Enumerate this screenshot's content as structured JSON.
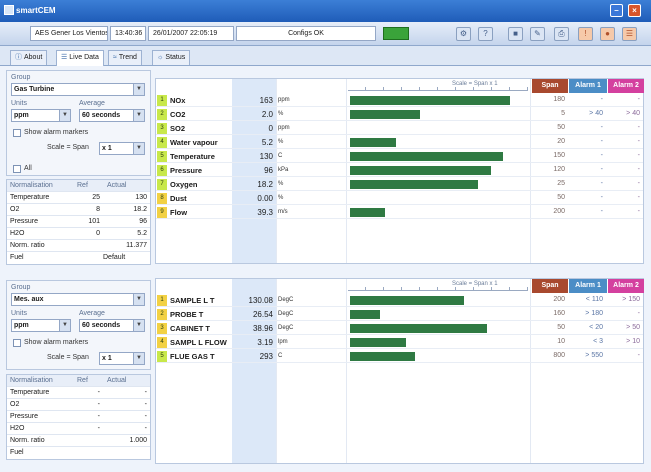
{
  "window": {
    "title": "smartCEM"
  },
  "toolbar": {
    "site": "AES Gener Los Vientos",
    "time": "13:40:36",
    "datetime": "26/01/2007 22:05:19",
    "status": "Configs OK"
  },
  "tabs": [
    {
      "label": "About",
      "icon": "info-icon"
    },
    {
      "label": "Live Data",
      "icon": "list-icon"
    },
    {
      "label": "Trend",
      "icon": "chart-icon"
    },
    {
      "label": "Status",
      "icon": "status-icon"
    }
  ],
  "colors": {
    "bar": "#2f7a43",
    "span_header": "#a8492f",
    "alarm1_header": "#4b8dc6",
    "alarm2_header": "#d4409f",
    "value_column": "#dce8f8"
  },
  "labels": {
    "group": "Group",
    "units": "Units",
    "average": "Average",
    "show_alarm_markers": "Show alarm markers",
    "scale_prefix": "Scale = Span",
    "all": "All",
    "scale_header": "Scale = Span x 1",
    "span": "Span",
    "alarm1": "Alarm 1",
    "alarm2": "Alarm 2",
    "normalisation": "Normalisation",
    "ref": "Ref",
    "actual": "Actual"
  },
  "panel1": {
    "group": "Gas Turbine",
    "units": "ppm",
    "average": "60 seconds",
    "scale": "x 1",
    "norm_rows": [
      {
        "name": "Temperature",
        "ref": "25",
        "actual": "130"
      },
      {
        "name": "O2",
        "ref": "8",
        "actual": "18.2"
      },
      {
        "name": "Pressure",
        "ref": "101",
        "actual": "96"
      },
      {
        "name": "H2O",
        "ref": "0",
        "actual": "5.2"
      },
      {
        "name": "Norm. ratio",
        "ref": "",
        "actual": "11.377"
      },
      {
        "name": "Fuel",
        "ref": "",
        "actual": "Default"
      }
    ],
    "rows": [
      {
        "n": "1",
        "color": "#c8e84a",
        "name": "NOx",
        "value": "163",
        "unit": "ppm",
        "fraction": 0.91,
        "span": "180",
        "a1": "-",
        "a2": "-"
      },
      {
        "n": "2",
        "color": "#c8e84a",
        "name": "CO2",
        "value": "2.0",
        "unit": "%",
        "fraction": 0.4,
        "span": "5",
        "a1": "> 40",
        "a2": "> 40"
      },
      {
        "n": "3",
        "color": "#c8e84a",
        "name": "SO2",
        "value": "0",
        "unit": "ppm",
        "fraction": 0.0,
        "span": "50",
        "a1": "-",
        "a2": "-"
      },
      {
        "n": "4",
        "color": "#c8e84a",
        "name": "Water vapour",
        "value": "5.2",
        "unit": "%",
        "fraction": 0.26,
        "span": "20",
        "a1": "-",
        "a2": "-"
      },
      {
        "n": "5",
        "color": "#c8e84a",
        "name": "Temperature",
        "value": "130",
        "unit": "C",
        "fraction": 0.87,
        "span": "150",
        "a1": "-",
        "a2": "-"
      },
      {
        "n": "6",
        "color": "#c8e84a",
        "name": "Pressure",
        "value": "96",
        "unit": "kPa",
        "fraction": 0.8,
        "span": "120",
        "a1": "-",
        "a2": "-"
      },
      {
        "n": "7",
        "color": "#c8e84a",
        "name": "Oxygen",
        "value": "18.2",
        "unit": "%",
        "fraction": 0.73,
        "span": "25",
        "a1": "-",
        "a2": "-"
      },
      {
        "n": "8",
        "color": "#f2d144",
        "name": "Dust",
        "value": "0.00",
        "unit": "%",
        "fraction": 0.0,
        "span": "50",
        "a1": "-",
        "a2": "-"
      },
      {
        "n": "9",
        "color": "#f2d144",
        "name": "Flow",
        "value": "39.3",
        "unit": "m/s",
        "fraction": 0.2,
        "span": "200",
        "a1": "-",
        "a2": "-"
      }
    ]
  },
  "panel2": {
    "group": "Mes. aux",
    "units": "ppm",
    "average": "60 seconds",
    "scale": "x 1",
    "norm_rows": [
      {
        "name": "Temperature",
        "ref": "-",
        "actual": "-"
      },
      {
        "name": "O2",
        "ref": "-",
        "actual": "-"
      },
      {
        "name": "Pressure",
        "ref": "-",
        "actual": "-"
      },
      {
        "name": "H2O",
        "ref": "-",
        "actual": "-"
      },
      {
        "name": "Norm. ratio",
        "ref": "",
        "actual": "1.000"
      },
      {
        "name": "Fuel",
        "ref": "",
        "actual": ""
      }
    ],
    "rows": [
      {
        "n": "1",
        "color": "#f2d144",
        "name": "SAMPLE L T",
        "value": "130.08",
        "unit": "DegC",
        "fraction": 0.65,
        "span": "200",
        "a1": "< 110",
        "a2": "> 150"
      },
      {
        "n": "2",
        "color": "#f2d144",
        "name": "PROBE T",
        "value": "26.54",
        "unit": "DegC",
        "fraction": 0.17,
        "span": "160",
        "a1": "> 180",
        "a2": "-"
      },
      {
        "n": "3",
        "color": "#f2d144",
        "name": "CABINET T",
        "value": "38.96",
        "unit": "DegC",
        "fraction": 0.78,
        "span": "50",
        "a1": "< 20",
        "a2": "> 50"
      },
      {
        "n": "4",
        "color": "#f2d144",
        "name": "SAMPL L FLOW",
        "value": "3.19",
        "unit": "lpm",
        "fraction": 0.32,
        "span": "10",
        "a1": "< 3",
        "a2": "> 10"
      },
      {
        "n": "5",
        "color": "#c8e84a",
        "name": "FLUE GAS T",
        "value": "293",
        "unit": "C",
        "fraction": 0.37,
        "span": "800",
        "a1": "> 550",
        "a2": "-"
      }
    ]
  }
}
